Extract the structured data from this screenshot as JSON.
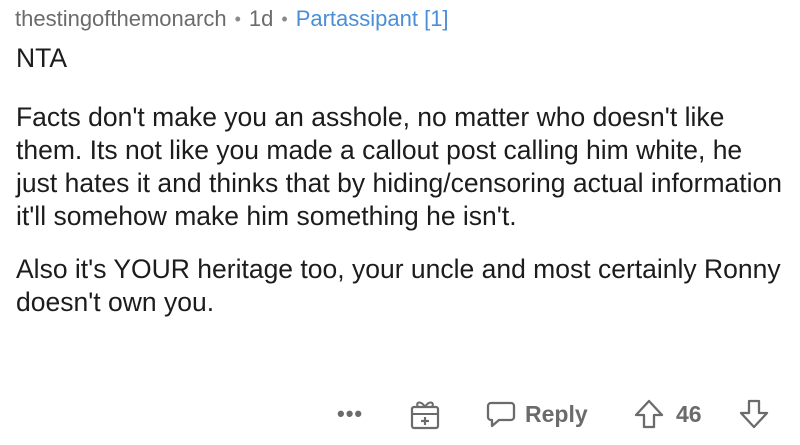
{
  "comment": {
    "author": "thestingofthemonarch",
    "separator": "•",
    "age": "1d",
    "flair": "Partassipant [1]",
    "verdict": "NTA",
    "paragraph_1": "Facts don't make you an asshole, no matter who doesn't like them. Its not like you made a callout post calling him white, he just hates it and thinks that by hiding/censoring actual information it'll somehow make him something he isn't.",
    "paragraph_2": "Also it's YOUR heritage too, your uncle and most certainly Ronny doesn't own you."
  },
  "actions": {
    "more_label": "•••",
    "more_icon": "ellipsis-icon",
    "award_icon": "gift-award-icon",
    "reply_icon": "speech-bubble-icon",
    "reply_label": "Reply",
    "upvote_icon": "arrow-up-icon",
    "score": "46",
    "downvote_icon": "arrow-down-icon"
  },
  "colors": {
    "text": "#1c1c1c",
    "muted": "#6b6b6b",
    "flair": "#4a8fd6"
  }
}
